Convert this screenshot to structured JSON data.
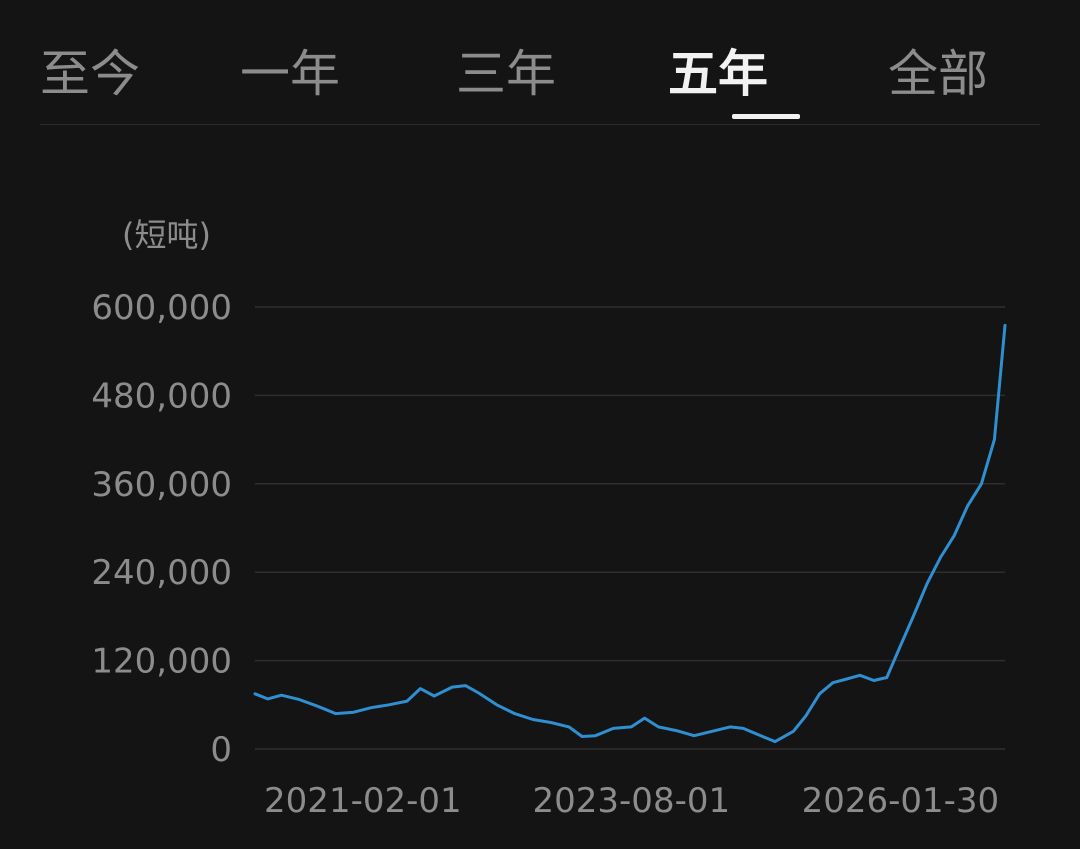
{
  "tabs": [
    {
      "label": "至今",
      "active": false
    },
    {
      "label": "一年",
      "active": false
    },
    {
      "label": "三年",
      "active": false
    },
    {
      "label": "五年",
      "active": true
    },
    {
      "label": "全部",
      "active": false
    }
  ],
  "colors": {
    "background": "#141414",
    "line": "#2f8fd0",
    "grid": "#2e2e2e",
    "text": "#8c8c8c",
    "active_text": "#f2f2f2"
  },
  "chart_data": {
    "type": "line",
    "title": "",
    "ylabel": "(短吨)",
    "xlabel": "",
    "ylim": [
      0,
      600000
    ],
    "yticks": [
      0,
      120000,
      240000,
      360000,
      480000,
      600000
    ],
    "ytick_labels": [
      "0",
      "120,000",
      "240,000",
      "360,000",
      "480,000",
      "600,000"
    ],
    "xtick_labels": [
      "2021-02-01",
      "2023-08-01",
      "2026-01-30"
    ],
    "grid": true,
    "series": [
      {
        "x": [
          "2020-02-01",
          "2020-03-15",
          "2020-05-01",
          "2020-07-01",
          "2020-09-01",
          "2020-11-01",
          "2021-01-01",
          "2021-03-01",
          "2021-05-01",
          "2021-07-01",
          "2021-08-15",
          "2021-10-01",
          "2021-12-01",
          "2022-01-15",
          "2022-03-01",
          "2022-05-01",
          "2022-07-01",
          "2022-09-01",
          "2022-11-01",
          "2023-01-01",
          "2023-02-15",
          "2023-04-01",
          "2023-06-01",
          "2023-08-01",
          "2023-09-15",
          "2023-11-01",
          "2024-01-01",
          "2024-03-01",
          "2024-05-01",
          "2024-07-01",
          "2024-08-15",
          "2024-10-01",
          "2024-12-01",
          "2025-02-01",
          "2025-03-15",
          "2025-05-01",
          "2025-06-15",
          "2025-08-01",
          "2025-09-15",
          "2025-11-01",
          "2025-12-15",
          "2026-01-30",
          "2026-03-15",
          "2026-05-01",
          "2026-06-15",
          "2026-08-01",
          "2026-09-15",
          "2026-11-01",
          "2026-12-15",
          "2027-01-20"
        ],
        "y": [
          75000,
          68000,
          73000,
          67000,
          58000,
          48000,
          50000,
          56000,
          60000,
          65000,
          82000,
          72000,
          84000,
          86000,
          76000,
          60000,
          48000,
          40000,
          36000,
          30000,
          17000,
          18000,
          28000,
          30000,
          42000,
          30000,
          25000,
          18000,
          24000,
          30000,
          28000,
          20000,
          10000,
          24000,
          45000,
          75000,
          90000,
          95000,
          100000,
          93000,
          97000,
          140000,
          180000,
          225000,
          260000,
          290000,
          330000,
          360000,
          420000,
          575000
        ]
      }
    ]
  }
}
